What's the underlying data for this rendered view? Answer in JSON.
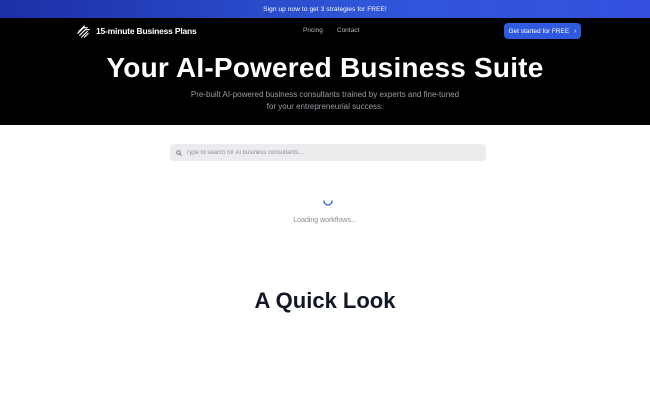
{
  "promo": {
    "text": "Sign up now to get 3 strategies for FREE!"
  },
  "header": {
    "logo_text": "15-minute Business Plans",
    "logo_icon": "logo-icon",
    "nav": [
      {
        "label": "Pricing"
      },
      {
        "label": "Contact"
      }
    ],
    "cta_label": "Get started for FREE",
    "cta_icon": "chevron-right-icon"
  },
  "hero": {
    "title": "Your AI-Powered Business Suite",
    "subtitle": "Pre-built AI-powered business consultants trained by experts and fine-tuned for your entrepreneurial success."
  },
  "search": {
    "placeholder": "Type to search for AI business consultants...",
    "value": "",
    "icon": "search-icon"
  },
  "loading": {
    "text": "Loading workflows...",
    "icon": "spinner-icon"
  },
  "section": {
    "title": "A Quick Look"
  },
  "colors": {
    "promo_gradient_start": "#1c2fa6",
    "promo_gradient_end": "#3550e0",
    "hero_bg": "#000000",
    "cta_bg": "#2f5ae0",
    "spinner": "#2f5ae0",
    "heading_dark": "#121826"
  }
}
